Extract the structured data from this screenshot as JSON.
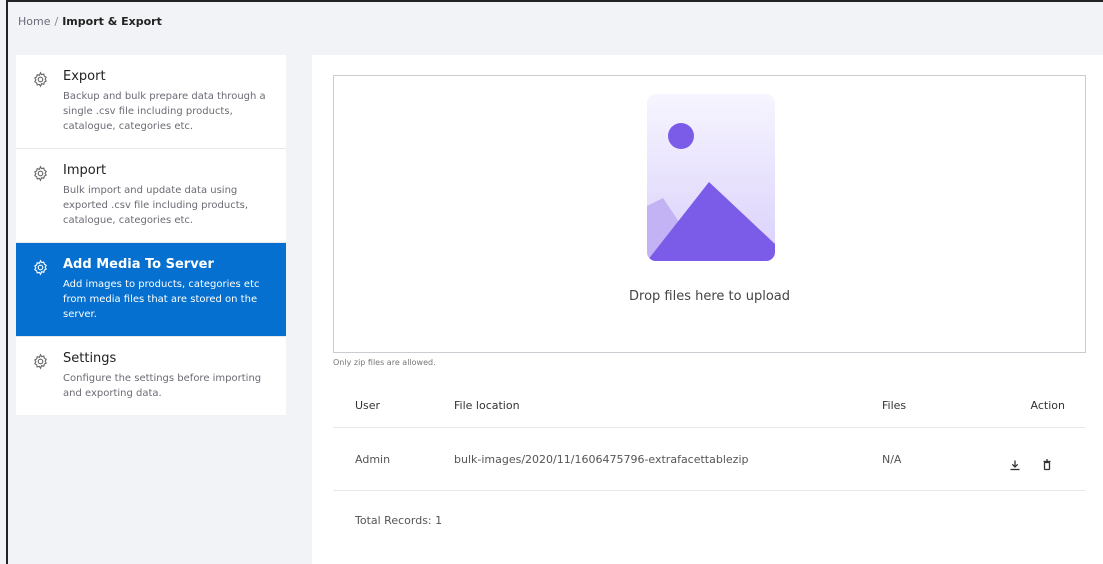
{
  "breadcrumb": {
    "home": "Home",
    "separator": "/",
    "current": "Import & Export"
  },
  "sidebar": {
    "items": [
      {
        "title": "Export",
        "desc": "Backup and bulk prepare data through a single .csv file including products, catalogue, categories etc.",
        "icon": "gear-icon",
        "active": false
      },
      {
        "title": "Import",
        "desc": "Bulk import and update data using exported .csv file including products, catalogue, categories etc.",
        "icon": "gear-icon",
        "active": false
      },
      {
        "title": "Add Media To Server",
        "desc": "Add images to products, categories etc from media files that are stored on the server.",
        "icon": "gear-icon",
        "active": true
      },
      {
        "title": "Settings",
        "desc": "Configure the settings before importing and exporting data.",
        "icon": "gear-icon",
        "active": false
      }
    ]
  },
  "dropzone": {
    "text": "Drop files here to upload",
    "hint": "Only zip files are allowed."
  },
  "table": {
    "headers": {
      "user": "User",
      "location": "File location",
      "files": "Files",
      "action": "Action"
    },
    "rows": [
      {
        "user": "Admin",
        "location": "bulk-images/2020/11/1606475796-extrafacettablezip",
        "files": "N/A"
      }
    ],
    "total": "Total Records: 1"
  },
  "colors": {
    "accent": "#0570cf",
    "illustration": "#7b5ce8",
    "page_bg": "#f1f3f6"
  }
}
